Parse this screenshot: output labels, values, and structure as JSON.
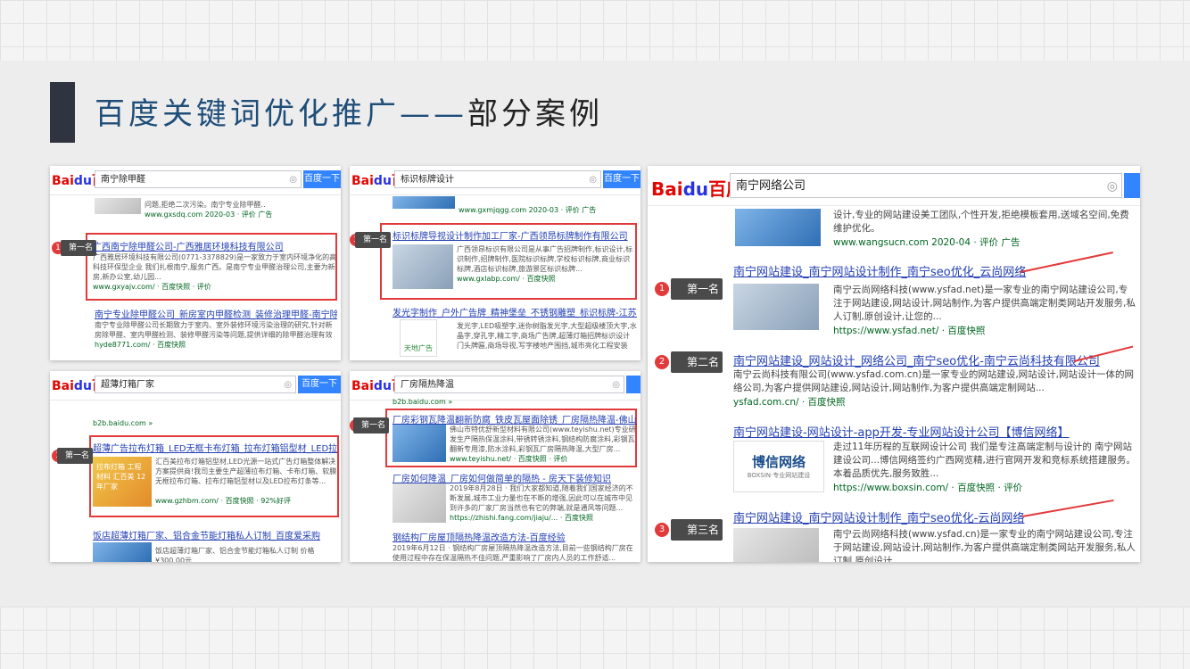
{
  "slide": {
    "title_main": "百度关键词优化推广——",
    "title_tail": "部分案例"
  },
  "common": {
    "logo": "Bai",
    "logo_du": "du",
    "logo_cn": "百度",
    "button": "百度一下",
    "rank1": "第一名",
    "rank2": "第二名",
    "rank3": "第三名"
  },
  "panels": [
    {
      "query": "南宁除甲醛",
      "r0": {
        "desc": "问题,拒绝二次污染。南宁专业除甲醛..",
        "url": "www.gxsdq.com 2020-03 · 评价 广告"
      },
      "r1": {
        "title": "广西南宁除甲醛公司-广西雅居环境科技有限公司",
        "desc": "广西雅居环境科技有限公司(0771-3378829)是一家致力于室内环境净化的高科技环保型企业 我们扎根南宁,服务广西。是南宁专业甲醛治理公司,主要为新房,新办公室,幼儿园...",
        "url": "www.gxyajv.com/ · 百度快照 · 评价"
      },
      "r2": {
        "title": "南宁专业除甲醛公司_新房室内甲醛检测_装修治理甲醛-南宁除甲醛公司",
        "desc": "南宁专业除甲醛公司长期致力于室内、室外装修环境污染治理的研究,针对新房除甲醛、室内甲醛检测、装修甲醛污染等问题,提供详细的除甲醛治理有效措施。",
        "url": "hyde8771.com/ · 百度快照"
      }
    },
    {
      "query": "标识标牌设计",
      "r0": {
        "desc": "",
        "url": "www.gxmjqgg.com 2020-03 · 评价 广告"
      },
      "r1": {
        "title": "标识标牌导视设计制作加工厂家-广西领昂标牌制作有限公司",
        "desc": "广西领昂标识有限公司是从事广告招牌制作,标识设计,标识制作,招牌制作,医院标识标牌,学校标识标牌,商业标识标牌,酒店标识标牌,旅游景区标识标牌...",
        "url": "www.gxlabp.com/ · 百度快照"
      },
      "r2": {
        "title": "发光字制作_户外广告牌_精神堡垒_不锈钢雕塑_标识标牌-江苏天地...",
        "desc": "发光字,LED吸塑字,迷你树脂发光字,大型超级楼顶大字,水晶字,穿孔字,精工字,商场广告牌,超薄灯箱招牌标识设计门头牌匾,商场导视,写字楼地产围挡,城市亮化工程安装",
        "url": "天地广告"
      }
    },
    {
      "query": "超薄灯箱厂家",
      "r0": {
        "desc": "",
        "url": "b2b.baidu.com »"
      },
      "r1": {
        "title": "超薄广告拉布灯箱_LED无框卡布灯箱_拉布灯箱铝型材_LED拉布灯条...",
        "desc": "汇百美拉布灯箱铝型材,LED光源一站式广告灯箱整体解决方案提供商!我司主要生产超薄拉布灯箱、卡布灯箱、软膜无框拉布灯箱、拉布灯箱铝型材以及LED拉布灯条等...",
        "url": "www.gzhbm.com/ · 百度快照 · 92%好评"
      },
      "r2": {
        "title": "饭店超薄灯箱厂家、铝合金节能灯箱私人订制_百度爱采购",
        "desc": "饭店超薄灯箱厂家、铝合金节能灯箱私人订制 价格 ¥300.00元",
        "url": ""
      },
      "thumb_label": "拉布灯箱 工程材料 汇百美 12年厂家"
    },
    {
      "query": "厂房隔热降温",
      "r0": {
        "desc": "",
        "url": "b2b.baidu.com »"
      },
      "r1": {
        "title": "厂房彩钢瓦降温翻新防腐_铁皮瓦屋面除锈_厂房隔热降温-佛山市...",
        "desc": "佛山市特优舒新型材料有限公司(www.teyishu.net)专业研发生产隔热保温涂料,带锈转锈涂料,钢结构防腐涂料,彩钢瓦翻新专用漆,防水涂料,彩钢瓦厂房隔热降温,大型厂房...",
        "url": "www.teyishu.net/ · 百度快照 · 评价"
      },
      "r2": {
        "title": "厂房如何降温_厂房如何做简单的隔热 - 房天下装修知识",
        "desc": "2019年8月28日 · 我们大家都知道,随着我们国家经济的不断发展,城市工业力量也在不断的增强,因此可以在城市中见到许多的厂家厂房当然也有它的弊端,就是通风等问题...",
        "url": "https://zhishi.fang.com/jiaju/... · 百度快照"
      },
      "r3": {
        "title": "钢结构厂房屋顶隔热降温改造方法-百度经验",
        "desc": "2019年6月12日 · 钢结构厂房屋顶隔热降温改造方法,目前一些钢结构厂房在使用过程中存在保温隔热不佳问题,严重影响了厂房内人员的工作舒适..."
      }
    }
  ],
  "big": {
    "query": "南宁网络公司",
    "r0": {
      "desc": "设计,专业的网站建设美工团队,个性开发,拒绝模板套用,送域名空间,免费维护优化。",
      "url": "www.wangsucn.com 2020-04 · 评价 广告"
    },
    "r1": {
      "title": "南宁网站建设_南宁网站设计制作_南宁seo优化_云尚网络",
      "desc": "南宁云尚网络科技(www.ysfad.net)是一家专业的南宁网站建设公司,专注于网站建设,网站设计,网站制作,为客户提供高端定制类网站开发服务,私人订制,原创设计,让您的...",
      "url": "https://www.ysfad.net/ · 百度快照"
    },
    "r2": {
      "title": "南宁网站建设_网站设计_网络公司_南宁seo优化-南宁云尚科技有限公司",
      "desc": "南宁云尚科技有限公司(www.ysfad.com.cn)是一家专业的网站建设,网站设计,网站设计一体的网络公司,为客户提供网站建设,网站设计,网站制作,为客户提供高端定制网站...",
      "url": "ysfad.com.cn/ · 百度快照"
    },
    "r3": {
      "title": "南宁网站建设-网站设计-app开发-专业网站设计公司【博信网络】",
      "desc": "走过11年历程的互联网设计公司 我们是专注高端定制与设计的 南宁网站建设公司...博信网络签约广西网览精,进行官网开发和竞标系统搭建服务。本着品质优先,服务致胜...",
      "url": "https://www.boxsin.com/ · 百度快照 · 评价",
      "logo_text": "博信网络",
      "logo_sub": "BOXSIN·专业网站建设"
    },
    "r4": {
      "title": "南宁网站建设_南宁网站设计制作_南宁seo优化-云尚网络",
      "desc": "南宁云尚网络科技(www.ysfad.cn)是一家专业的南宁网站建设公司,专注于网站建设,网站设计,网站制作,为客户提供高端定制类网站开发服务,私人订制,原创设计..."
    }
  }
}
